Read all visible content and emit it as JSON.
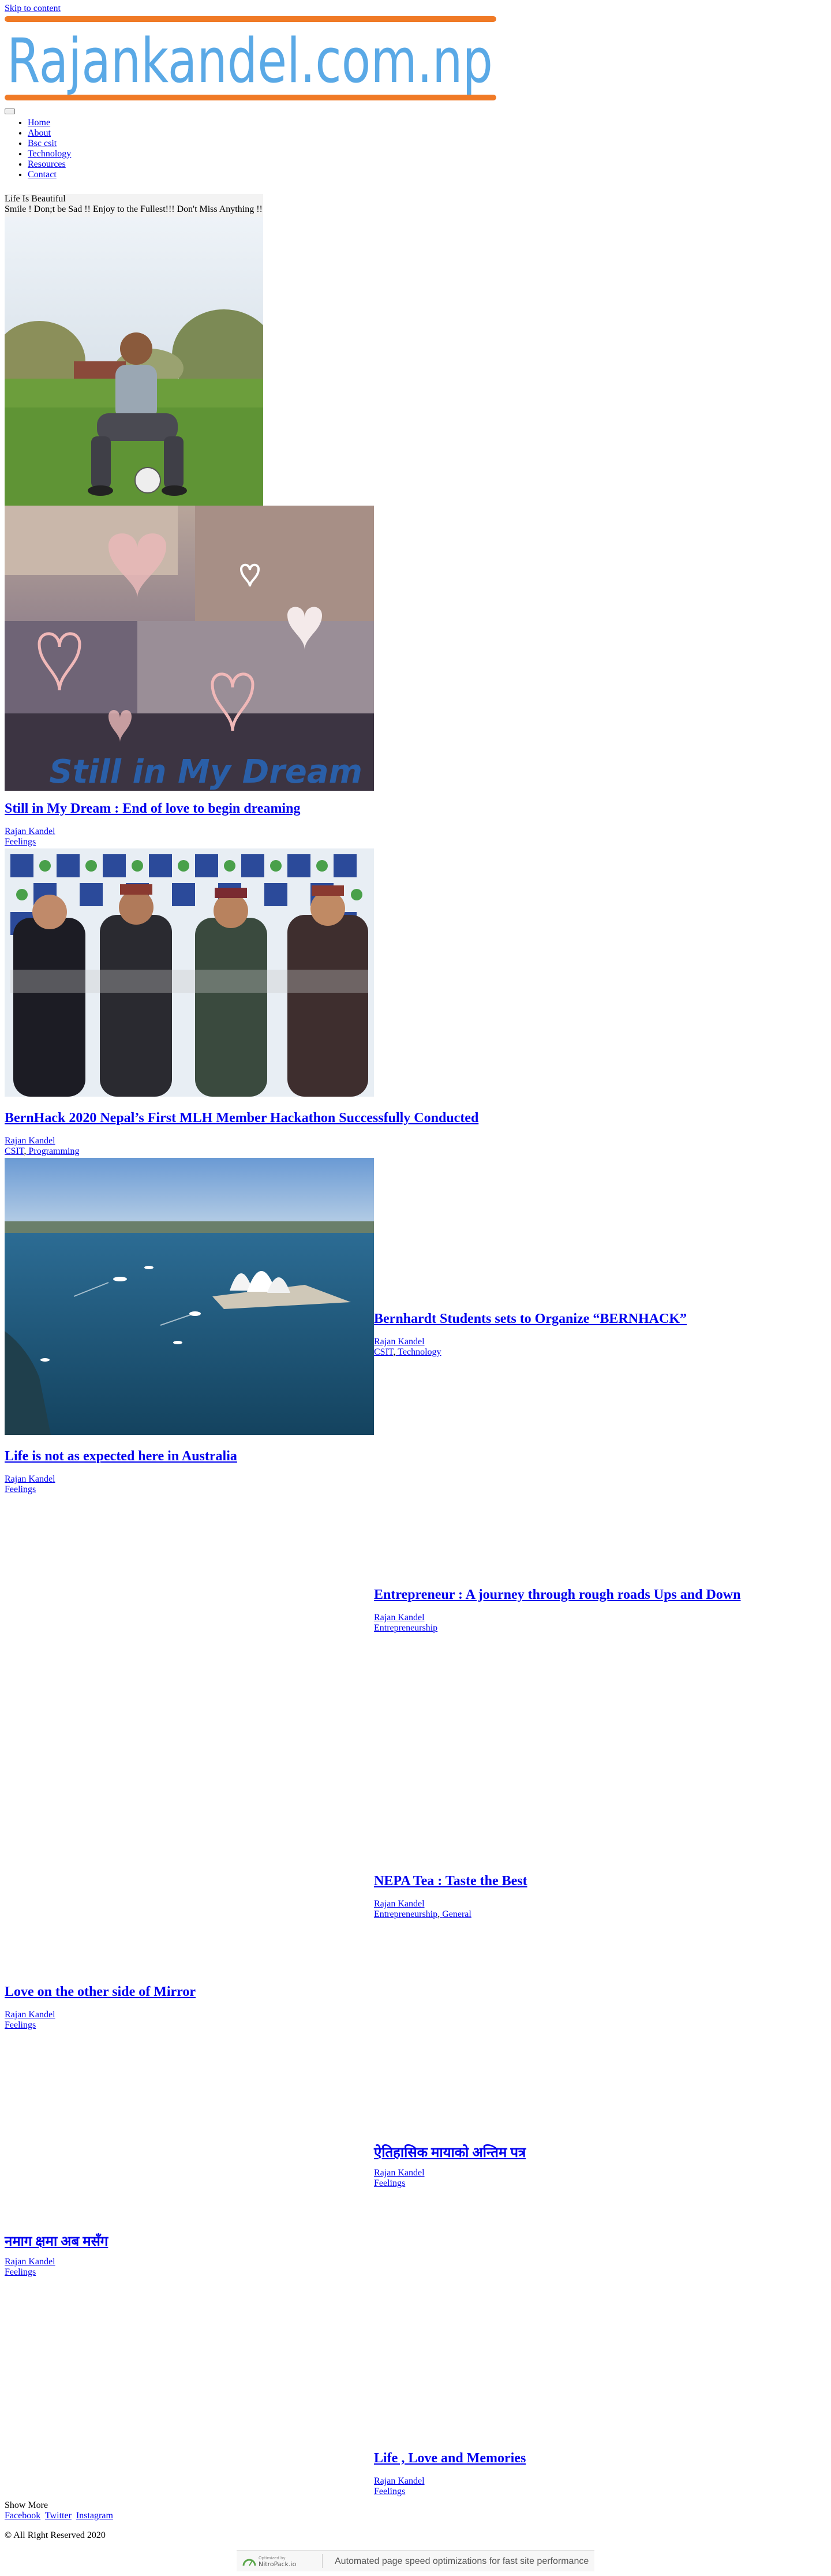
{
  "skip_link": "Skip to content",
  "site": {
    "logo_text": "Rajankandel.com.np",
    "logo_colors": {
      "text": "#5aa9e6",
      "bar": "#f07a26"
    }
  },
  "nav": {
    "items": [
      "Home",
      "About",
      "Bsc csit",
      "Technology",
      "Resources",
      "Contact"
    ]
  },
  "profile": {
    "title": "Life Is Beautiful",
    "tagline": "Smile ! Don;t be Sad !! Enjoy to the Fullest!!! Don't Miss Anything !!"
  },
  "posts": [
    {
      "title": "Still in My Dream : End of love to begin dreaming",
      "author": "Rajan Kandel",
      "categories": [
        "Feelings"
      ],
      "image_caption": "Still in My Dream"
    },
    {
      "title": "BernHack 2020 Nepal’s First MLH Member Hackathon Successfully Conducted",
      "author": "Rajan Kandel",
      "categories": [
        "CSIT",
        "Programming"
      ]
    },
    {
      "title": "Bernhardt Students sets to Organize “BERNHACK”",
      "author": "Rajan Kandel",
      "categories": [
        "CSIT",
        "Technology"
      ]
    },
    {
      "title": "Life is not as expected here in Australia",
      "author": "Rajan Kandel",
      "categories": [
        "Feelings"
      ]
    },
    {
      "title": "Entrepreneur : A journey through rough roads Ups and Down",
      "author": "Rajan Kandel",
      "categories": [
        "Entrepreneurship"
      ]
    },
    {
      "title": "NEPA Tea : Taste the Best",
      "author": "Rajan Kandel",
      "categories": [
        "Entrepreneurship",
        "General"
      ]
    },
    {
      "title": "Love on the other side of Mirror",
      "author": "Rajan Kandel",
      "categories": [
        "Feelings"
      ]
    },
    {
      "title": "ऐतिहासिक मायाको अन्तिम पत्र",
      "author": "Rajan Kandel",
      "categories": [
        "Feelings"
      ]
    },
    {
      "title": "नमाग क्षमा अब मसँग",
      "author": "Rajan Kandel",
      "categories": [
        "Feelings"
      ]
    },
    {
      "title": "Life , Love and Memories",
      "author": "Rajan Kandel",
      "categories": [
        "Feelings"
      ]
    }
  ],
  "show_more": "Show More",
  "social": [
    "Facebook",
    "Twitter",
    "Instagram"
  ],
  "copyright": "© All Right Reserved 2020",
  "metro_bar": {
    "logo_small": "Optimized by",
    "logo_name": "NitroPack.io",
    "text": "Automated page speed optimizations for fast site performance"
  }
}
